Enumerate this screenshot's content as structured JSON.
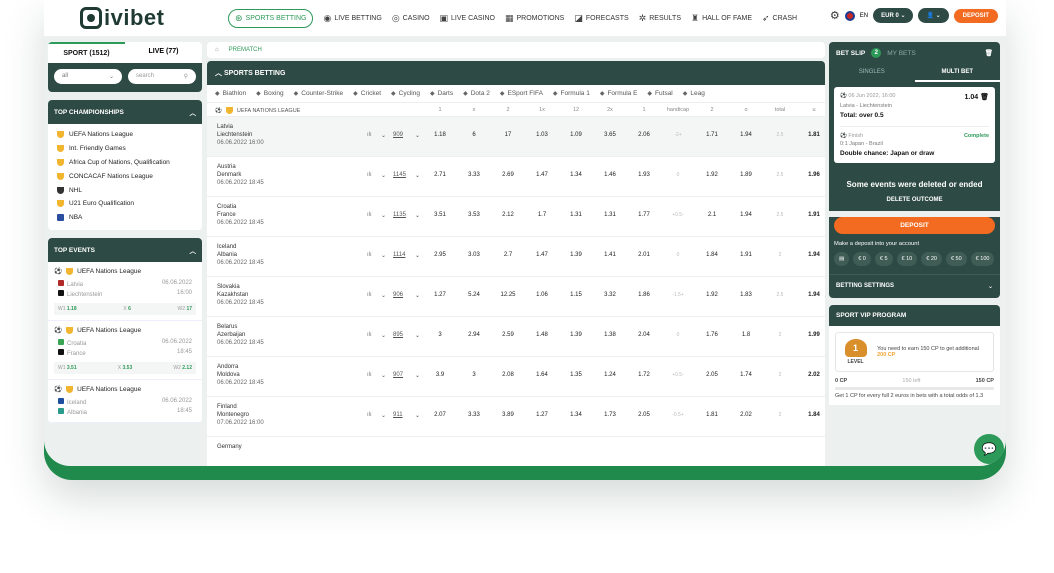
{
  "brand": {
    "logo": "ivibet"
  },
  "nav": [
    {
      "label": "SPORTS BETTING",
      "active": true
    },
    {
      "label": "LIVE BETTING"
    },
    {
      "label": "CASINO"
    },
    {
      "label": "LIVE CASINO"
    },
    {
      "label": "PROMOTIONS"
    },
    {
      "label": "FORECASTS"
    },
    {
      "label": "RESULTS"
    },
    {
      "label": "HALL OF FAME"
    },
    {
      "label": "CRASH"
    }
  ],
  "header_right": {
    "lang": "EN",
    "currency": "EUR 0",
    "deposit": "DEPOSIT"
  },
  "left": {
    "sport_tab": "SPORT (1512)",
    "live_tab": "LIVE (77)",
    "filter_value": "all",
    "search_placeholder": "search",
    "top_championships_title": "TOP CHAMPIONSHIPS",
    "championships": [
      "UEFA Nations League",
      "Int. Friendly Games",
      "Africa Cup of Nations, Qualification",
      "CONCACAF Nations League",
      "NHL",
      "U21 Euro Qualification",
      "NBA"
    ],
    "top_events_title": "TOP EVENTS",
    "events": [
      {
        "league": "UEFA Nations League",
        "home": "Latvia",
        "away": "Liechtenstein",
        "date": "06.06.2022",
        "time": "16:00",
        "w1": "1.18",
        "x": "6",
        "w2": "17"
      },
      {
        "league": "UEFA Nations League",
        "home": "Croatia",
        "away": "France",
        "date": "06.06.2022",
        "time": "18:45",
        "w1": "3.51",
        "x": "3.53",
        "w2": "2.12"
      },
      {
        "league": "UEFA Nations League",
        "home": "Iceland",
        "away": "Albania",
        "date": "06.06.2022",
        "time": "18:45"
      }
    ],
    "odds_labels": {
      "w1": "W1",
      "x": "X",
      "w2": "W2"
    }
  },
  "center": {
    "breadcrumb": "PREMATCH",
    "section_title": "SPORTS BETTING",
    "sports": [
      "Biathlon",
      "Boxing",
      "Counter-Strike",
      "Cricket",
      "Cycling",
      "Darts",
      "Dota 2",
      "ESport FIFA",
      "Formula 1",
      "Formula E",
      "Futsal",
      "Leag"
    ],
    "league": "UEFA NATIONS LEAGUE",
    "columns": [
      "1",
      "x",
      "2",
      "1x",
      "12",
      "2x",
      "1",
      "handicap",
      "2",
      "o",
      "total",
      "u"
    ],
    "rows": [
      {
        "home": "Latvia",
        "away": "Liechtenstein",
        "date": "06.06.2022 16:00",
        "count": "909",
        "odds": [
          "1.18",
          "6",
          "17",
          "1.03",
          "1.09",
          "3.65",
          "2.06",
          "-2+",
          "1.71",
          "1.94",
          "2.5",
          "1.81"
        ]
      },
      {
        "home": "Austria",
        "away": "Denmark",
        "date": "06.06.2022 18:45",
        "count": "1145",
        "odds": [
          "2.71",
          "3.33",
          "2.69",
          "1.47",
          "1.34",
          "1.46",
          "1.93",
          "0",
          "1.92",
          "1.89",
          "2.5",
          "1.96"
        ]
      },
      {
        "home": "Croatia",
        "away": "France",
        "date": "06.06.2022 18:45",
        "count": "1135",
        "odds": [
          "3.51",
          "3.53",
          "2.12",
          "1.7",
          "1.31",
          "1.31",
          "1.77",
          "+0.5-",
          "2.1",
          "1.94",
          "2.5",
          "1.91"
        ]
      },
      {
        "home": "Iceland",
        "away": "Albania",
        "date": "06.06.2022 18:45",
        "count": "1114",
        "odds": [
          "2.95",
          "3.03",
          "2.7",
          "1.47",
          "1.39",
          "1.41",
          "2.01",
          "0",
          "1.84",
          "1.91",
          "2",
          "1.94"
        ]
      },
      {
        "home": "Slovakia",
        "away": "Kazakhstan",
        "date": "06.06.2022 18:45",
        "count": "906",
        "odds": [
          "1.27",
          "5.24",
          "12.25",
          "1.06",
          "1.15",
          "3.32",
          "1.86",
          "-1.5+",
          "1.92",
          "1.83",
          "2.5",
          "1.94"
        ]
      },
      {
        "home": "Belarus",
        "away": "Azerbaijan",
        "date": "06.06.2022 18:45",
        "count": "895",
        "odds": [
          "3",
          "2.94",
          "2.59",
          "1.48",
          "1.39",
          "1.38",
          "2.04",
          "0",
          "1.76",
          "1.8",
          "2",
          "1.99"
        ]
      },
      {
        "home": "Andorra",
        "away": "Moldova",
        "date": "06.06.2022 18:45",
        "count": "907",
        "odds": [
          "3.9",
          "3",
          "2.08",
          "1.64",
          "1.35",
          "1.24",
          "1.72",
          "+0.5-",
          "2.05",
          "1.74",
          "2",
          "2.02"
        ]
      },
      {
        "home": "Finland",
        "away": "Montenegro",
        "date": "07.06.2022 16:00",
        "count": "911",
        "odds": [
          "2.07",
          "3.33",
          "3.89",
          "1.27",
          "1.34",
          "1.73",
          "2.05",
          "-0.5+",
          "1.81",
          "2.02",
          "2",
          "1.84"
        ]
      },
      {
        "home": "Germany",
        "away": "",
        "date": "",
        "count": "",
        "odds": []
      }
    ]
  },
  "betslip": {
    "title": "BET SLIP",
    "count": "2",
    "my_bets": "MY BETS",
    "tab_singles": "SINGLES",
    "tab_multi": "MULTI BET",
    "bet1": {
      "date": "06 Jun 2022, 16:00",
      "match": "Latvia - Liechtenstein",
      "odds": "1.04",
      "pick": "Total: over 0.5"
    },
    "bet2": {
      "status_label": "Finish",
      "status": "Complete",
      "match": "0:1  Japan - Brazil",
      "pick": "Double chance: Japan or draw"
    },
    "warning": "Some events were deleted or ended",
    "delete": "DELETE OUTCOME",
    "deposit": "DEPOSIT",
    "make_deposit": "Make a deposit into your account",
    "chips": [
      "€ 0",
      "€ 5",
      "€ 10",
      "€ 20",
      "€ 50",
      "€ 100"
    ],
    "settings": "BETTING SETTINGS"
  },
  "vip": {
    "title": "SPORT VIP PROGRAM",
    "level": "LEVEL",
    "level_num": "1",
    "text": "You need to earn 150 CP to get additional",
    "bonus": "200 CP",
    "start": "0 CP",
    "left": "150 left",
    "end": "150 CP",
    "note": "Get 1 CP for every full 2 euros in bets with a total odds of 1.3"
  }
}
